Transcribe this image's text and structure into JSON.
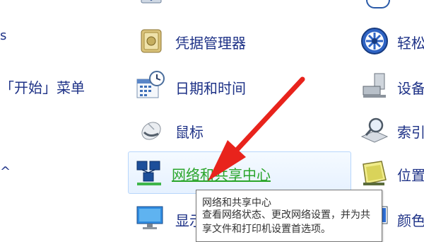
{
  "left_column": {
    "start_menu_label": "「开始」菜单"
  },
  "middle_column": {
    "items": [
      {
        "label": "凭据管理器",
        "icon": "credential-manager-icon"
      },
      {
        "label": "日期和时间",
        "icon": "date-time-icon"
      },
      {
        "label": "鼠标",
        "icon": "mouse-icon"
      },
      {
        "label": "网络和共享中心",
        "icon": "network-sharing-icon"
      },
      {
        "label": "显示",
        "icon": "display-icon"
      }
    ]
  },
  "right_column": {
    "items": [
      {
        "label": "轻松",
        "icon": "ease-of-access-icon"
      },
      {
        "label": "设备",
        "icon": "devices-icon"
      },
      {
        "label": "索引",
        "icon": "indexing-icon"
      },
      {
        "label": "位置",
        "icon": "location-icon"
      },
      {
        "label": "颜色",
        "icon": "color-icon"
      }
    ]
  },
  "tooltip": {
    "title": "网络和共享中心",
    "description": "查看网络状态、更改网络设置，并为共享文件和打印机设置首选项。"
  },
  "colors": {
    "link_blue": "#1e3287",
    "hover_green": "#2aa52a",
    "arrow_red": "#e8231c"
  }
}
